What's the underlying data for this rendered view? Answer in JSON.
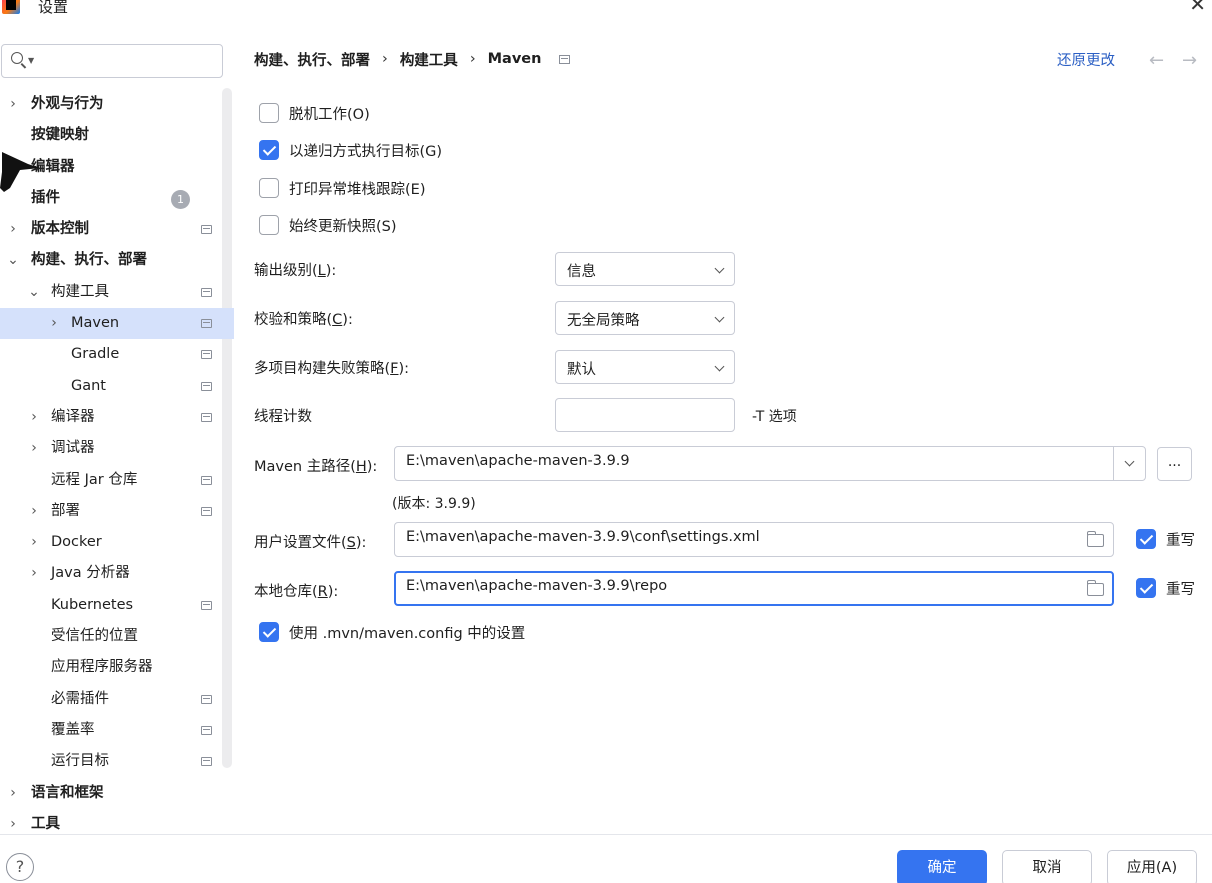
{
  "window": {
    "title": "设置"
  },
  "search": {
    "placeholder": ""
  },
  "sidebar": {
    "badge_count": "1",
    "items": [
      {
        "label": "外观与行为"
      },
      {
        "label": "按键映射"
      },
      {
        "label": "编辑器"
      },
      {
        "label": "插件"
      },
      {
        "label": "版本控制"
      },
      {
        "label": "构建、执行、部署"
      },
      {
        "label": "构建工具"
      },
      {
        "label": "Maven"
      },
      {
        "label": "Gradle"
      },
      {
        "label": "Gant"
      },
      {
        "label": "编译器"
      },
      {
        "label": "调试器"
      },
      {
        "label": "远程 Jar 仓库"
      },
      {
        "label": "部署"
      },
      {
        "label": "Docker"
      },
      {
        "label": "Java 分析器"
      },
      {
        "label": "Kubernetes"
      },
      {
        "label": "受信任的位置"
      },
      {
        "label": "应用程序服务器"
      },
      {
        "label": "必需插件"
      },
      {
        "label": "覆盖率"
      },
      {
        "label": "运行目标"
      },
      {
        "label": "语言和框架"
      },
      {
        "label": "工具"
      }
    ]
  },
  "header": {
    "breadcrumb": [
      "构建、执行、部署",
      "构建工具",
      "Maven"
    ],
    "reset_label": "还原更改",
    "back_glyph": "←",
    "forward_glyph": "→"
  },
  "options": {
    "offline": {
      "label": "脱机工作(O)",
      "checked": false
    },
    "recursive": {
      "label": "以递归方式执行目标(G)",
      "checked": true
    },
    "print_stack": {
      "label": "打印异常堆栈跟踪(E)",
      "checked": false
    },
    "always_update": {
      "label": "始终更新快照(S)",
      "checked": false
    }
  },
  "fields": {
    "output_level": {
      "label_pre": "输出级别(",
      "mnemonic": "L",
      "label_post": "):",
      "value": "信息"
    },
    "checksum": {
      "label_pre": "校验和策略(",
      "mnemonic": "C",
      "label_post": "):",
      "value": "无全局策略"
    },
    "multiproject": {
      "label_pre": "多项目构建失败策略(",
      "mnemonic": "F",
      "label_post": "):",
      "value": "默认"
    },
    "threads": {
      "label": "线程计数",
      "value": "",
      "suffix": "-T 选项"
    },
    "maven_home": {
      "label_pre": "Maven 主路径(",
      "mnemonic": "H",
      "label_post": "):",
      "value": "E:\\maven\\apache-maven-3.9.9",
      "version_note": "(版本: 3.9.9)",
      "browse_label": "..."
    },
    "user_settings": {
      "label_pre": "用户设置文件(",
      "mnemonic": "S",
      "label_post": "):",
      "value": "E:\\maven\\apache-maven-3.9.9\\conf\\settings.xml",
      "override_label": "重写",
      "override_checked": true
    },
    "local_repo": {
      "label_pre": "本地仓库(",
      "mnemonic": "R",
      "label_post": "):",
      "value": "E:\\maven\\apache-maven-3.9.9\\repo",
      "override_label": "重写",
      "override_checked": true
    },
    "use_mvn_config": {
      "label": "使用 .mvn/maven.config 中的设置",
      "checked": true
    }
  },
  "footer": {
    "help_glyph": "?",
    "ok_label": "确定",
    "cancel_label": "取消",
    "apply_label": "应用(A)"
  },
  "colors": {
    "accent": "#3574f0",
    "selection": "#d5e1fb",
    "link": "#2b5fc4"
  }
}
